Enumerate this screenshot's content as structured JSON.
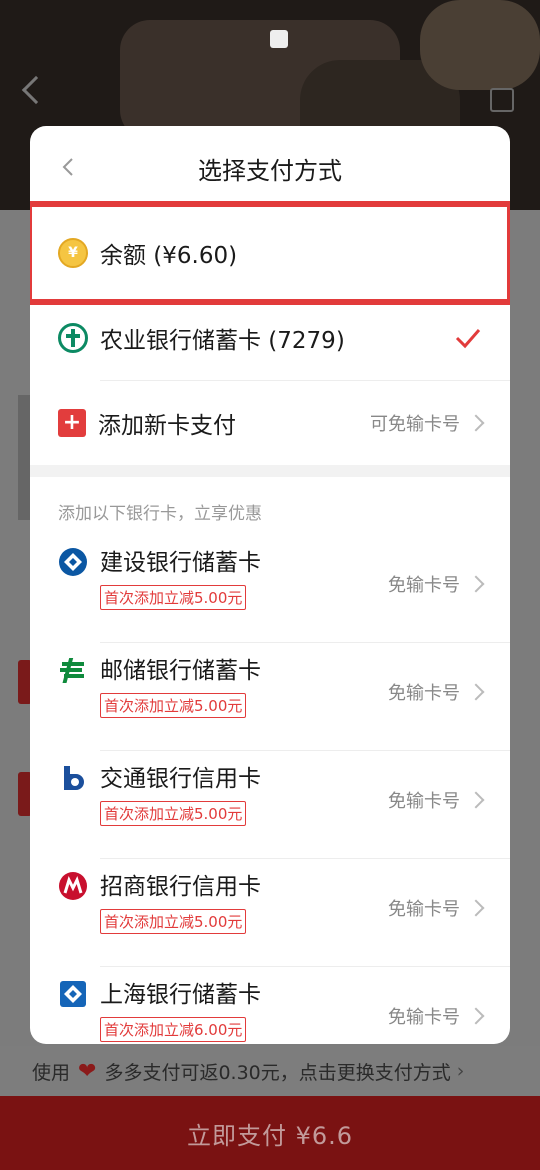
{
  "modal": {
    "title": "选择支付方式",
    "balance_label": "余额 (¥6.60)",
    "abc_card_label": "农业银行储蓄卡 (7279)",
    "add_card_label": "添加新卡支付",
    "add_card_hint": "可免输卡号",
    "section_title": "添加以下银行卡，立享优惠",
    "banks": [
      {
        "name": "建设银行储蓄卡",
        "promo": "首次添加立减5.00元",
        "hint": "免输卡号",
        "icon": "ccb-icon"
      },
      {
        "name": "邮储银行储蓄卡",
        "promo": "首次添加立减5.00元",
        "hint": "免输卡号",
        "icon": "psbc-icon"
      },
      {
        "name": "交通银行信用卡",
        "promo": "首次添加立减5.00元",
        "hint": "免输卡号",
        "icon": "bocom-icon"
      },
      {
        "name": "招商银行信用卡",
        "promo": "首次添加立减5.00元",
        "hint": "免输卡号",
        "icon": "cmb-icon"
      },
      {
        "name": "上海银行储蓄卡",
        "promo": "首次添加立减6.00元",
        "hint": "免输卡号",
        "icon": "bosc-icon"
      }
    ]
  },
  "bottom": {
    "hint_prefix": "使用",
    "hint_text": "多多支付可返0.30元，点击更换支付方式",
    "pay_button": "立即支付 ¥6.6"
  },
  "colors": {
    "accent_red": "#e23b3b",
    "abc_green": "#0c8a63"
  }
}
